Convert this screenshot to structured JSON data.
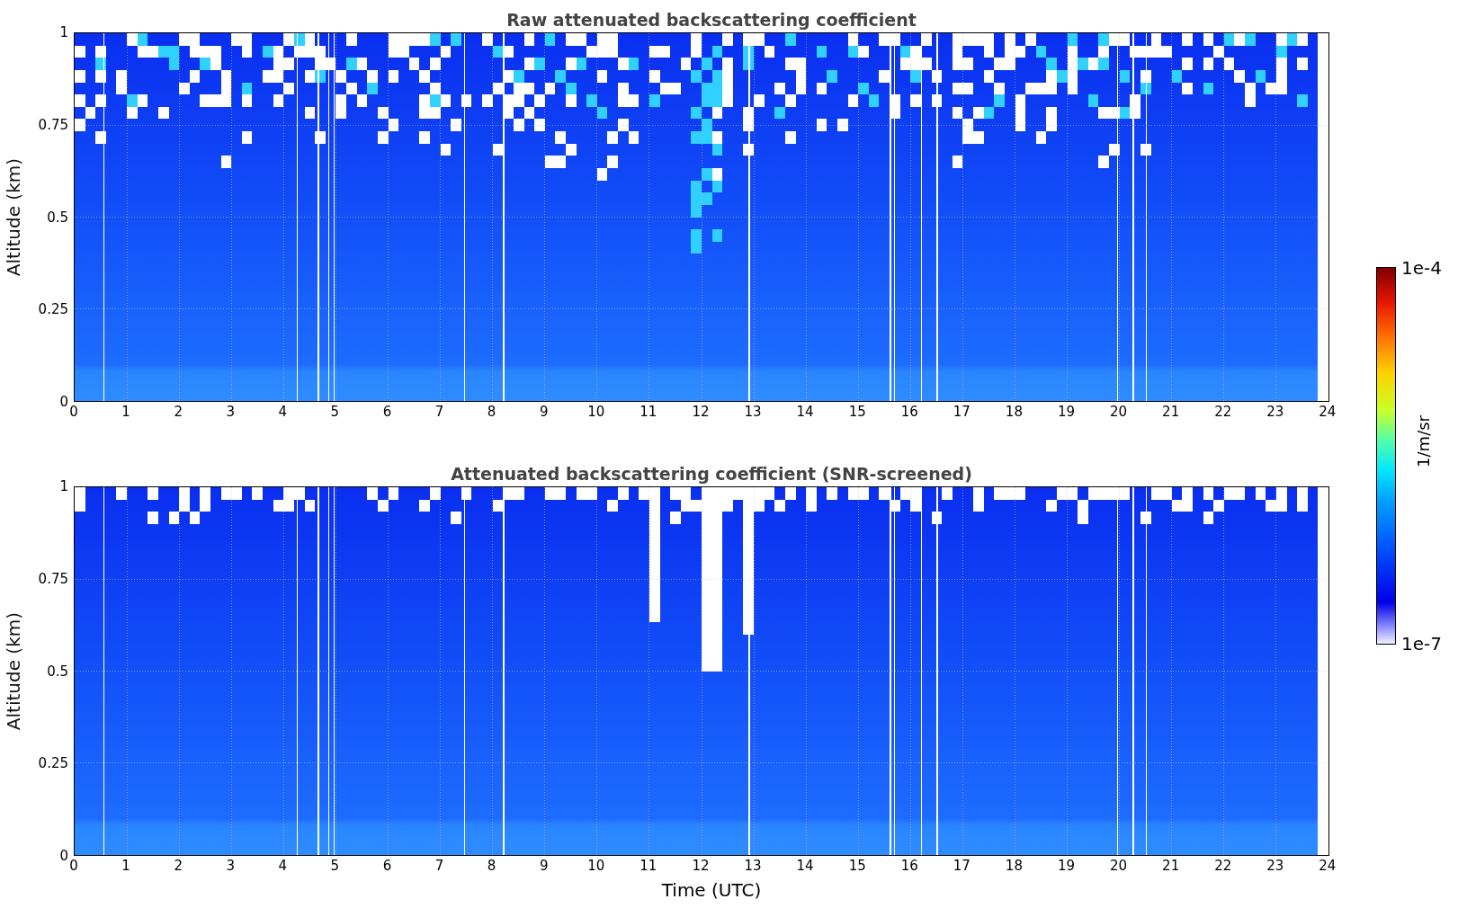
{
  "panels": [
    {
      "kind": "raw",
      "title": "Raw attenuated backscattering coefficient",
      "ylabel": "Altitude (km)",
      "yticks": [
        "1",
        "0.75",
        "0.5",
        "0.25",
        "0"
      ],
      "xticks": [
        "0",
        "1",
        "2",
        "3",
        "4",
        "5",
        "6",
        "7",
        "8",
        "9",
        "10",
        "11",
        "12",
        "13",
        "14",
        "15",
        "16",
        "17",
        "18",
        "19",
        "20",
        "21",
        "22",
        "23",
        "24"
      ]
    },
    {
      "kind": "screened",
      "title": "Attenuated backscattering coefficient (SNR-screened)",
      "ylabel": "Altitude (km)",
      "yticks": [
        "1",
        "0.75",
        "0.5",
        "0.25",
        "0"
      ],
      "xticks": [
        "0",
        "1",
        "2",
        "3",
        "4",
        "5",
        "6",
        "7",
        "8",
        "9",
        "10",
        "11",
        "12",
        "13",
        "14",
        "15",
        "16",
        "17",
        "18",
        "19",
        "20",
        "21",
        "22",
        "23",
        "24"
      ]
    }
  ],
  "xlabel": "Time (UTC)",
  "colorbar": {
    "max_label": "1e-4",
    "min_label": "1e-7",
    "unit": "1/m/sr"
  }
}
